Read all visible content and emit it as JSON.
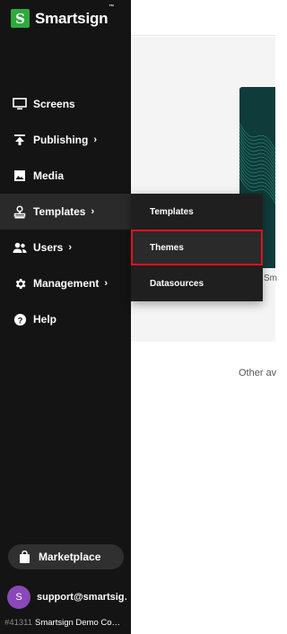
{
  "brand": {
    "name": "Smartsign",
    "tm": "™",
    "mark": "S"
  },
  "nav": {
    "items": [
      {
        "label": "Screens",
        "icon": "monitor-icon",
        "chevron": ""
      },
      {
        "label": "Publishing",
        "icon": "publish-upload-icon",
        "chevron": "›"
      },
      {
        "label": "Media",
        "icon": "image-icon",
        "chevron": ""
      },
      {
        "label": "Templates",
        "icon": "stamp-icon",
        "chevron": "›"
      },
      {
        "label": "Users",
        "icon": "users-icon",
        "chevron": "›"
      },
      {
        "label": "Management",
        "icon": "gear-icon",
        "chevron": "›"
      },
      {
        "label": "Help",
        "icon": "help-icon",
        "chevron": ""
      }
    ]
  },
  "flyout": {
    "items": [
      {
        "label": "Templates"
      },
      {
        "label": "Themes"
      },
      {
        "label": "Datasources"
      }
    ]
  },
  "marketplace": {
    "label": "Marketplace",
    "icon": "shopping-bag-icon"
  },
  "user": {
    "initial": "S",
    "email": "support@smartsig…",
    "org_id": "#41311",
    "org_name": "Smartsign Demo Co…"
  },
  "main": {
    "thumb_caption": "Sm",
    "other_text": "Other av"
  },
  "colors": {
    "sidebar": "#141414",
    "accent": "#2eaa3c",
    "avatar": "#8b48b8",
    "highlight": "#e0121f"
  }
}
